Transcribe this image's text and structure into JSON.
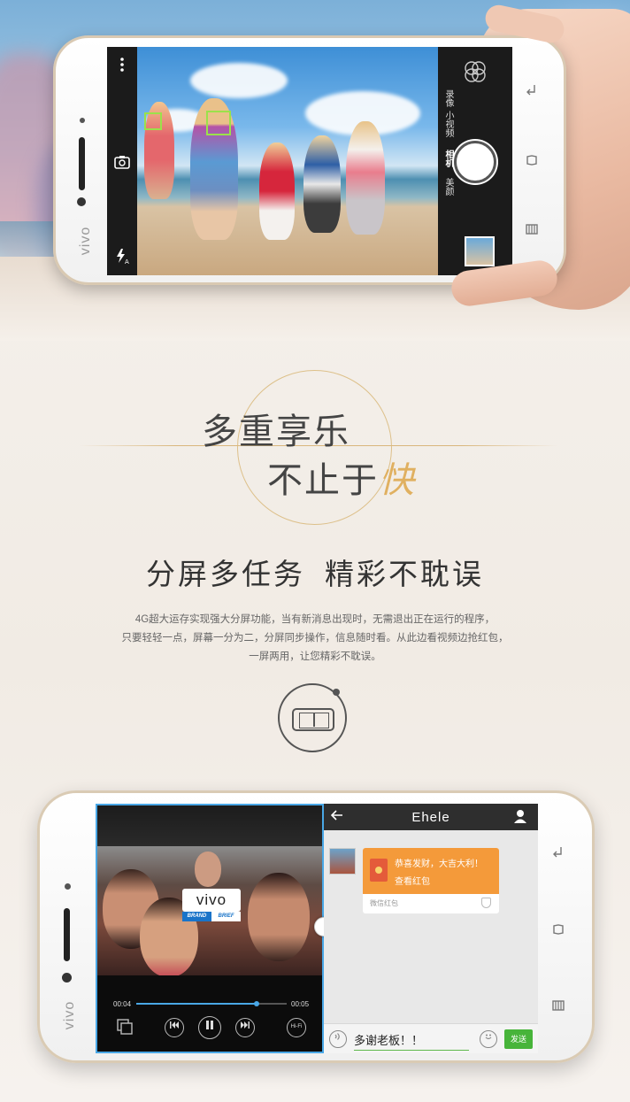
{
  "hero": {
    "phone_brand": "vivo",
    "camera": {
      "modes": [
        "录像",
        "小视频",
        "相机",
        "美颜"
      ],
      "active_mode": "相机",
      "menu_icon": "more-vertical-icon",
      "flash_icon": "flash-auto-icon",
      "switch_icon": "switch-camera-icon",
      "filter_icon": "filter-icon"
    },
    "nav_keys": [
      "back-icon",
      "home-icon",
      "menu-icon"
    ]
  },
  "slogan": {
    "line1": "多重享乐",
    "line2_prefix": "不止于",
    "line2_emphasis": "快",
    "accent_color": "#e0b060"
  },
  "section": {
    "heading_part1": "分屏多任务",
    "heading_part2": "精彩不耽误",
    "description_lines": [
      "4G超大运存实现强大分屏功能，当有新消息出现时，无需退出正在运行的程序，",
      "只要轻轻一点，屏幕一分为二，分屏同步操作，信息随时看。从此边看视频边抢红包，",
      "一屏两用，让您精彩不耽误。"
    ],
    "icon": "split-screen-icon"
  },
  "phone2": {
    "brand": "vivo",
    "video": {
      "badge_logo": "vivo",
      "badge_left": "BRAND",
      "badge_right": "BRIEF",
      "time_current": "00:04",
      "time_total": "00:05",
      "progress": 0.8,
      "accent_color": "#49a7e6",
      "controls": [
        "prev-icon",
        "pause-icon",
        "next-icon"
      ],
      "hifi_label": "Hi-Fi"
    },
    "chat": {
      "title": "Ehele",
      "redpacket_line1": "恭喜发财，大吉大利！",
      "redpacket_line2": "查看红包",
      "redpacket_footer": "微信红包",
      "input_text": "多谢老板！！",
      "send_label": "发送",
      "redpacket_color": "#f49a3a",
      "send_color": "#47b43a"
    }
  }
}
